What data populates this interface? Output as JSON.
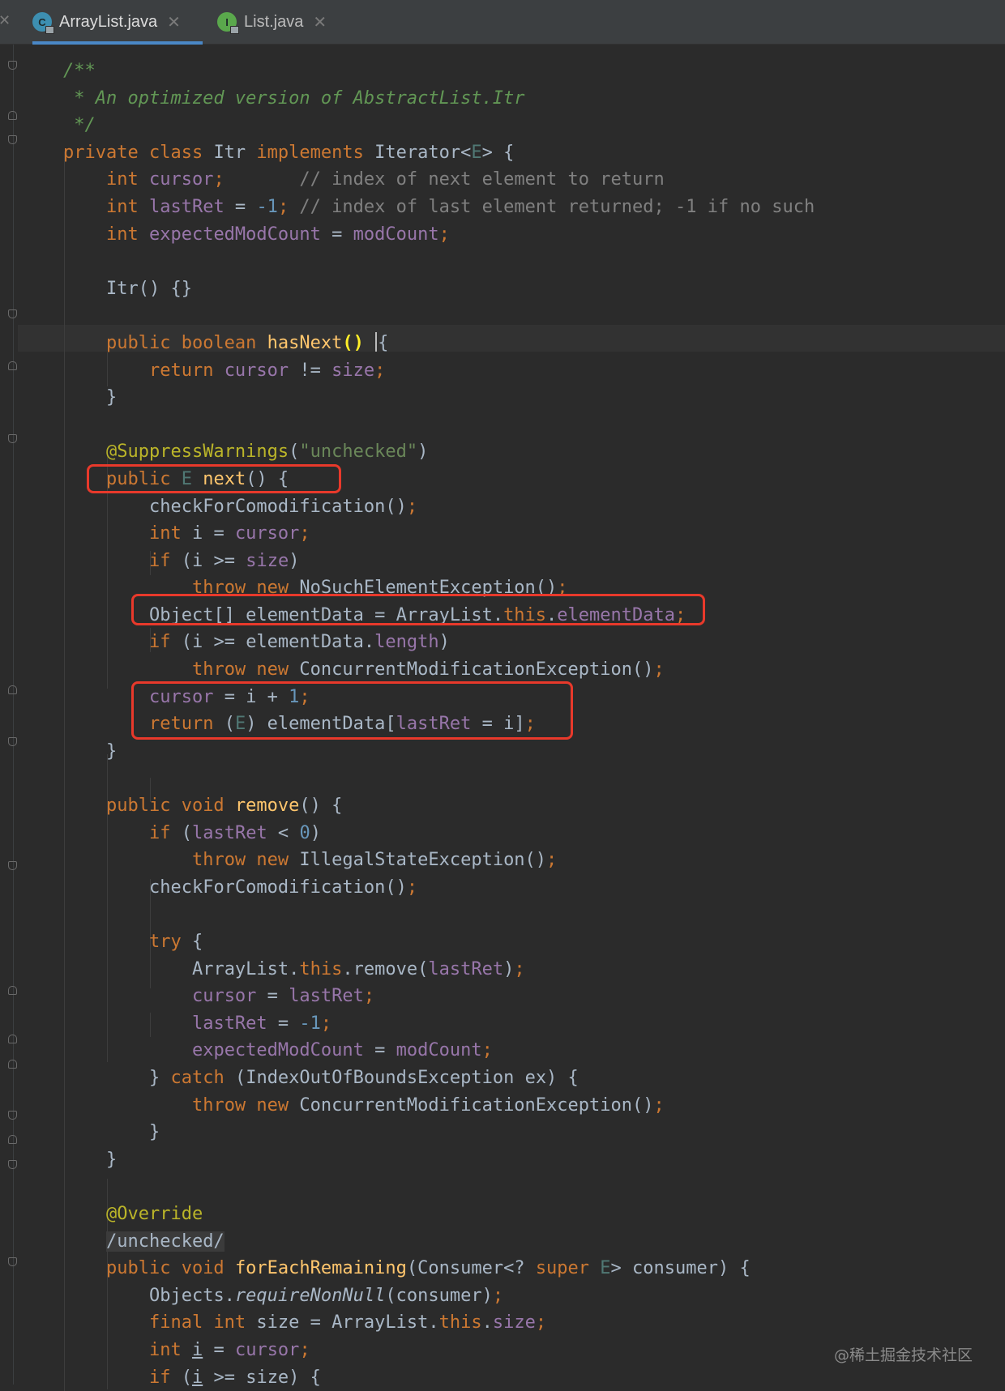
{
  "tabs": [
    {
      "label": "ArrayList.java",
      "icon_letter": "C",
      "icon_color": "#3d8fb1",
      "active": true
    },
    {
      "label": "List.java",
      "icon_letter": "I",
      "icon_color": "#5aa84c",
      "active": false
    }
  ],
  "watermark": "@稀土掘金技术社区",
  "code": {
    "l1": "/**",
    "l2": " * An optimized version of AbstractList.Itr",
    "l3": " */",
    "l4_kw": "private class ",
    "l4_name": "Itr ",
    "l4_kw2": "implements ",
    "l4_type": "Iterator<",
    "l4_E": "E",
    "l4_end": "> {",
    "l5_kw": "int ",
    "l5_fld": "cursor",
    "l5_semi": ";",
    "l5_cm": "       // index of next element to return",
    "l6_kw": "int ",
    "l6_fld": "lastRet",
    "l6_eq": " = ",
    "l6_num": "-1",
    "l6_semi": ";",
    "l6_cm": " // index of last element returned; -1 if no such",
    "l7_kw": "int ",
    "l7_fld": "expectedModCount",
    "l7_eq": " = ",
    "l7_fld2": "modCount",
    "l7_semi": ";",
    "l9": "Itr() {}",
    "l11_kw": "public boolean ",
    "l11_fn": "hasNext",
    "l11_paren": "()",
    "l11_brace": "{",
    "l12_kw": "return ",
    "l12_fld": "cursor",
    "l12_op": " != ",
    "l12_fld2": "size",
    "l12_semi": ";",
    "l13": "}",
    "l15_ann": "@SuppressWarnings",
    "l15_open": "(",
    "l15_str": "\"unchecked\"",
    "l15_close": ")",
    "l16_kw": "public ",
    "l16_E": "E ",
    "l16_fn": "next",
    "l16_end": "() {",
    "l17_call": "checkForComodification()",
    "l17_semi": ";",
    "l18_kw": "int ",
    "l18_mid": "i = ",
    "l18_fld": "cursor",
    "l18_semi": ";",
    "l19_kw": "if ",
    "l19_mid": "(i >= ",
    "l19_fld": "size",
    "l19_end": ")",
    "l20_kw": "throw new ",
    "l20_call": "NoSuchElementException()",
    "l20_semi": ";",
    "l21_a": "Object[] elementData = ArrayList.",
    "l21_kw": "this",
    "l21_dot": ".",
    "l21_fld": "elementData",
    "l21_semi": ";",
    "l22_kw": "if ",
    "l22_mid": "(i >= elementData.",
    "l22_fld": "length",
    "l22_end": ")",
    "l23_kw": "throw new ",
    "l23_call": "ConcurrentModificationException()",
    "l23_semi": ";",
    "l24_fld": "cursor",
    "l24_mid": " = i + ",
    "l24_num": "1",
    "l24_semi": ";",
    "l25_kw": "return ",
    "l25_open": "(",
    "l25_E": "E",
    "l25_mid": ") elementData[",
    "l25_fld": "lastRet",
    "l25_end": " = i]",
    "l25_semi": ";",
    "l26": "}",
    "l28_kw": "public void ",
    "l28_fn": "remove",
    "l28_end": "() {",
    "l29_kw": "if ",
    "l29_open": "(",
    "l29_fld": "lastRet",
    "l29_op": " < ",
    "l29_num": "0",
    "l29_end": ")",
    "l30_kw": "throw new ",
    "l30_call": "IllegalStateException()",
    "l30_semi": ";",
    "l31_call": "checkForComodification()",
    "l31_semi": ";",
    "l33_kw": "try ",
    "l33_end": "{",
    "l34_a": "ArrayList.",
    "l34_kw": "this",
    "l34_b": ".remove(",
    "l34_fld": "lastRet",
    "l34_c": ")",
    "l34_semi": ";",
    "l35_fld": "cursor",
    "l35_eq": " = ",
    "l35_fld2": "lastRet",
    "l35_semi": ";",
    "l36_fld": "lastRet",
    "l36_eq": " = ",
    "l36_num": "-1",
    "l36_semi": ";",
    "l37_fld": "expectedModCount",
    "l37_eq": " = ",
    "l37_fld2": "modCount",
    "l37_semi": ";",
    "l38_a": "} ",
    "l38_kw": "catch ",
    "l38_b": "(IndexOutOfBoundsException ex) {",
    "l39_kw": "throw new ",
    "l39_call": "ConcurrentModificationException()",
    "l39_semi": ";",
    "l40": "}",
    "l41": "}",
    "l43_ann": "@Override",
    "l44_lbl": "/unchecked/",
    "l45_kw": "public void ",
    "l45_fn": "forEachRemaining",
    "l45_a": "(Consumer<? ",
    "l45_kw2": "super ",
    "l45_E": "E",
    "l45_b": "> consumer) {",
    "l46_a": "Objects.",
    "l46_st": "requireNonNull",
    "l46_b": "(consumer)",
    "l46_semi": ";",
    "l47_kw": "final int ",
    "l47_a": "size = ArrayList.",
    "l47_kw2": "this",
    "l47_dot": ".",
    "l47_fld": "size",
    "l47_semi": ";",
    "l48_kw": "int ",
    "l48_i": "i",
    "l48_eq": " = ",
    "l48_fld": "cursor",
    "l48_semi": ";",
    "l49_kw": "if ",
    "l49_a": "(",
    "l49_i": "i",
    "l49_b": " >= size) {"
  }
}
